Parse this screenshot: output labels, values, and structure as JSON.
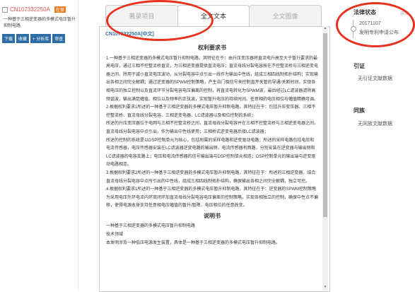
{
  "left": {
    "pub_no": "CN107332250A",
    "badge": "在审",
    "title": "一种基于三相逆变器的多模式电压暂升抑制电路",
    "buttons": [
      "下载",
      "收藏",
      "+ 分析库",
      "审查"
    ]
  },
  "tabs": [
    "著录项目",
    "全文文本",
    "全文图像"
  ],
  "active_tab": 1,
  "doc_id": "CN107332250A[中文]",
  "claims": {
    "heading": "权利要求书",
    "paragraphs": [
      "1.一种基于三相逆变器的多模式电压暂升抑制电路，其特征在于：由升压变压器将直流电升高至大于暂升要求的最高电压，通过三相不控整流桥直流，为三相逆变器提供直流电压；直流母线分裂电容按在不控整流桥与三相逆变电器之间，除用于减小直流电压波动，从分裂电容中点引出一线作为输出中性线，组成三相四线制拓扑结构；实现输出各相之间完全解耦；通过逆变器的SPWM控制策略，产生自门极信号来控制直开关管的导通/关断时间，实现各相电压的独立控制以及直流环节分裂电容电压偏离的控制，将直流电转化为SPWM波，最后经过LC滤波器滤除高频谐波，输出满足幅值、相位以及频率的正弦波，实现暂升电压的持续时间、任意相的电压相位与幅值精确可调。",
      "2.根据权利要求1所述的一种基于三相逆变器的多模式电压暂升抑制电路，其特征在于：包括升压变压器、三相不控整流桥、直流母线分裂电容、三相逆变电器、LC滤波器以及相位控制的系统；",
      "所述的升压变压器位于电网与三相不控整流桥之间，直流母线分裂电容并在三相不控整流桥与三相逆变电器之间，直流母线分裂电容中点引出，作为输出中性线使用；三相桥式逆变电器后接LC滤波器；",
      "所述的控制的系统是以DSP控制单元为核心，包括附属的采样电路和逆变驱动电路；所述的采样电路包括电压和电流传感器，电压传感器安装在LC滤波器逆变电路的输出侧，电流传感器有两路，分别安装在逆变器与输出侧和LC滤波器的电容支路上；电压和电流传感器的信号输出端与DSP控制单元相连；DSP控制单元的输出端与逆变驱动电路相连。",
      "3.根据权利要求2所述的一种基于三相逆变器的多模式电压暂升抑制电路，其特征在于：所述的三相逆变器，结合直流母线分裂电容中点所引出的中性线，组成三相四线制拓扑结构，确保输出各相之间完全解耦，独立可控。",
      "4.根据权利要求1所述的一种基于三相逆变器的多模式电压暂升抑制电路，其特征在于：逆变器的SPWM控制策略为采用电压外环电流内环双闭环加直流母线分裂电容电压偏差的控制策略，实现各相独立的控制，确保中性点不偏移，使得电源本身支持任意相电压幅值的暂升/暂降，电压相位的任意改变。"
    ]
  },
  "desc": {
    "heading": "说明书",
    "lines": [
      "一种基于三相逆变器的多模式电压暂升抑制电路",
      "技术领域",
      "本发明涉及一种低压电源发生装置，具体是一种基于三相逆变器的多模式电压暂升抑制电路。"
    ]
  },
  "right": {
    "legal_status": "法律状态",
    "more": "详情",
    "date": "20171107",
    "status": "发明专利申请公布",
    "citation": "引证",
    "citation_empty": "无引证文献数据",
    "family": "同族",
    "family_empty": "无同族文献数据"
  }
}
